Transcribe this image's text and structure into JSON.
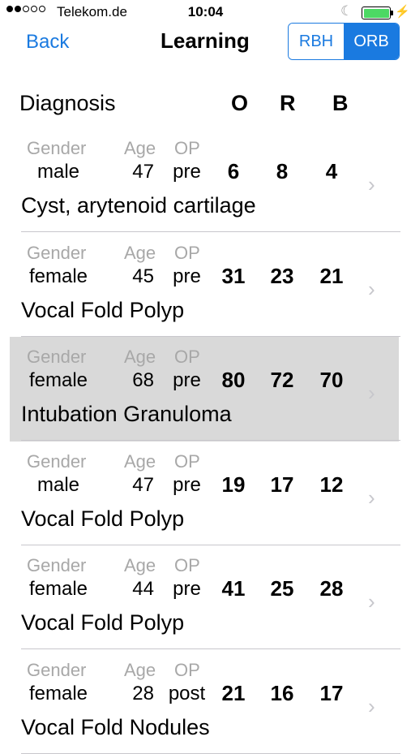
{
  "status": {
    "carrier": "Telekom.de",
    "time": "10:04",
    "battery_level": 1.0
  },
  "nav": {
    "back_label": "Back",
    "title": "Learning",
    "segments": [
      "RBH",
      "ORB"
    ],
    "selected_segment": "ORB"
  },
  "header": {
    "diagnosis": "Diagnosis",
    "col_o": "O",
    "col_r": "R",
    "col_b": "B"
  },
  "labels": {
    "gender": "Gender",
    "age": "Age",
    "op": "OP"
  },
  "rows": [
    {
      "gender": "male",
      "age": "47",
      "op": "pre",
      "o": "6",
      "r": "8",
      "b": "4",
      "diagnosis": "Cyst, arytenoid cartilage"
    },
    {
      "gender": "female",
      "age": "45",
      "op": "pre",
      "o": "31",
      "r": "23",
      "b": "21",
      "diagnosis": "Vocal Fold Polyp"
    },
    {
      "gender": "female",
      "age": "68",
      "op": "pre",
      "o": "80",
      "r": "72",
      "b": "70",
      "diagnosis": "Intubation Granuloma",
      "selected": true
    },
    {
      "gender": "male",
      "age": "47",
      "op": "pre",
      "o": "19",
      "r": "17",
      "b": "12",
      "diagnosis": "Vocal Fold Polyp"
    },
    {
      "gender": "female",
      "age": "44",
      "op": "pre",
      "o": "41",
      "r": "25",
      "b": "28",
      "diagnosis": "Vocal Fold Polyp"
    },
    {
      "gender": "female",
      "age": "28",
      "op": "post",
      "o": "21",
      "r": "16",
      "b": "17",
      "diagnosis": "Vocal Fold Nodules"
    }
  ]
}
